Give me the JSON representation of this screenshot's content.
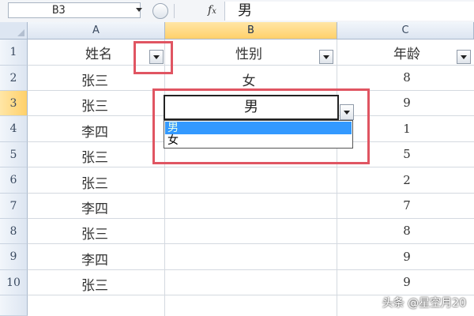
{
  "formula_bar": {
    "name_box": "B3",
    "fx_label": "fx",
    "formula": "男"
  },
  "columns": [
    "A",
    "B",
    "C"
  ],
  "rows": [
    "1",
    "2",
    "3",
    "4",
    "5",
    "6",
    "7",
    "8",
    "9",
    "10"
  ],
  "header_row": {
    "A": "姓名",
    "B": "性别",
    "C": "年龄"
  },
  "data_rows": [
    {
      "A": "张三",
      "B": "女",
      "C": "8"
    },
    {
      "A": "张三",
      "B": "男",
      "C": "9"
    },
    {
      "A": "李四",
      "B": "",
      "C": "1"
    },
    {
      "A": "张三",
      "B": "",
      "C": "5"
    },
    {
      "A": "张三",
      "B": "",
      "C": "2"
    },
    {
      "A": "李四",
      "B": "",
      "C": "7"
    },
    {
      "A": "张三",
      "B": "",
      "C": "8"
    },
    {
      "A": "李四",
      "B": "",
      "C": "9"
    },
    {
      "A": "张三",
      "B": "",
      "C": "9"
    }
  ],
  "active_cell": "B3",
  "dropdown_options": [
    "男",
    "女"
  ],
  "dropdown_selected": "男",
  "watermark": "头条 @星空月20",
  "colors": {
    "highlight_red": "#e05562",
    "selected_option": "#3399ff",
    "active_header": "#ffd06a"
  }
}
